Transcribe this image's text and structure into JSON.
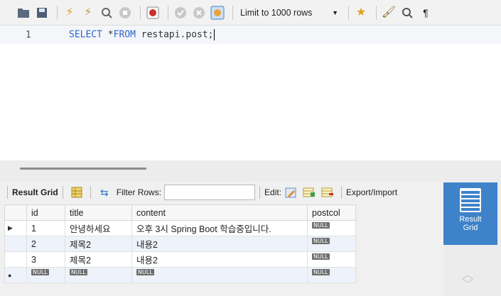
{
  "toolbar": {
    "limit_label": "Limit to 1000 rows",
    "icons": [
      "folder-icon",
      "save-icon",
      "execute-icon",
      "execute-current-icon",
      "explain-icon",
      "stop-icon",
      "toggle-error-icon",
      "commit-icon",
      "rollback-icon",
      "autocommit-icon",
      "beautify-icon",
      "find-icon",
      "invisible-chars-icon"
    ]
  },
  "editor": {
    "line_number": "1",
    "kw_select": "SELECT",
    "star": "*",
    "kw_from": "FROM",
    "table": "restapi.post;"
  },
  "result_toolbar": {
    "result_grid": "Result Grid",
    "filter_rows": "Filter Rows:",
    "filter_value": "",
    "edit": "Edit:",
    "export_import": "Export/Import"
  },
  "right_panel": {
    "result_grid_l1": "Result",
    "result_grid_l2": "Grid"
  },
  "grid": {
    "columns": [
      "id",
      "title",
      "content",
      "postcol"
    ],
    "null_label": "NULL",
    "rows": [
      {
        "id": "1",
        "title": "안녕하세요",
        "content": "오후 3시 Spring Boot 학습중입니다."
      },
      {
        "id": "2",
        "title": "제목2",
        "content": "내용2"
      },
      {
        "id": "3",
        "title": "제목2",
        "content": "내용2"
      }
    ]
  },
  "colors": {
    "accent": "#3e82c9",
    "keyword": "#2b63c6",
    "row_alt": "#eef2fb"
  }
}
